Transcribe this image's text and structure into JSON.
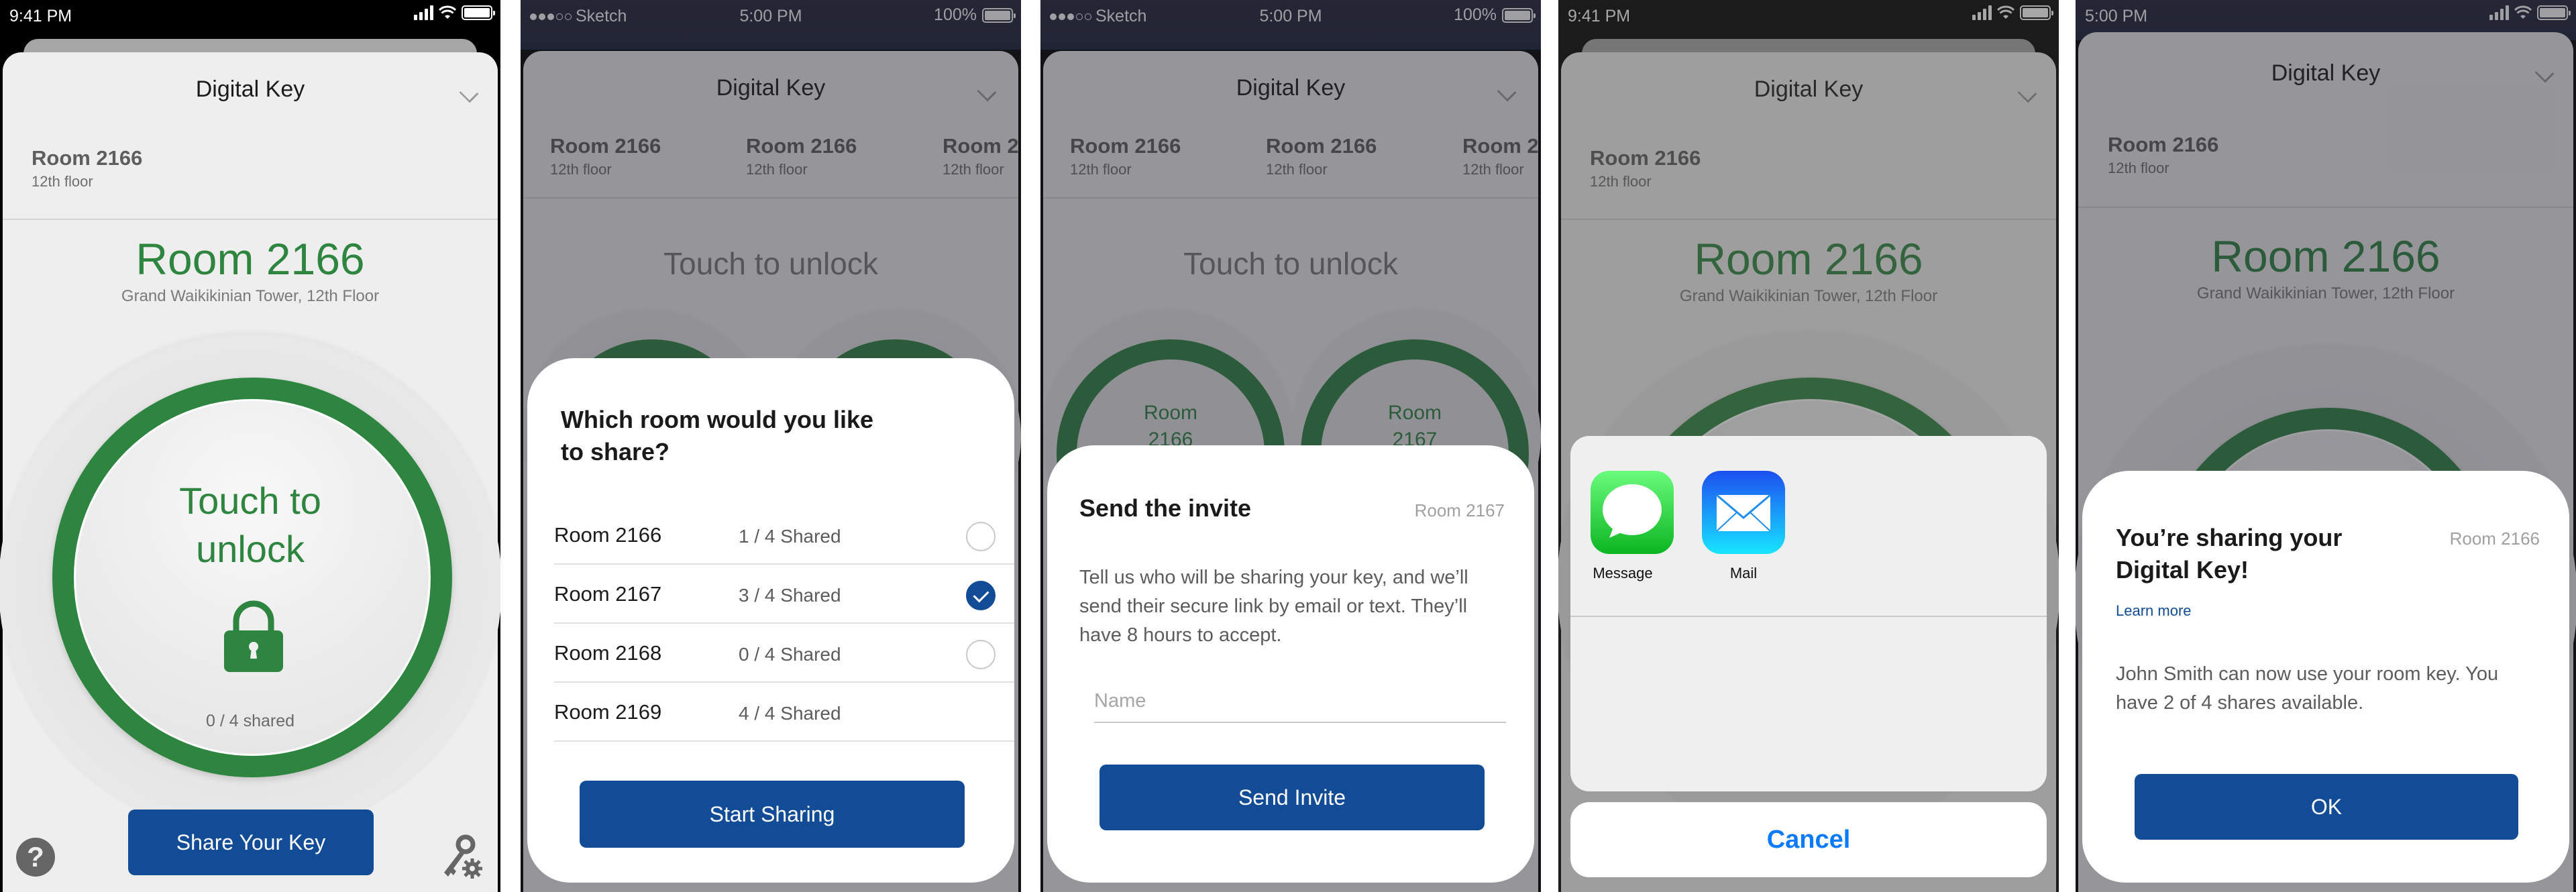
{
  "colors": {
    "brand_green": "#2e8540",
    "brand_blue": "#124b96",
    "ios_blue": "#0a7aff"
  },
  "screens": [
    {
      "status": {
        "time": "9:41 PM"
      },
      "header": {
        "title": "Digital Key"
      },
      "room_tab": {
        "room": "Room 2166",
        "floor": "12th floor"
      },
      "room_title": "Room 2166",
      "room_subtitle": "Grand Waikikinian Tower, 12th Floor",
      "unlock": {
        "line1": "Touch to",
        "line2": "unlock",
        "icon": "lock-icon"
      },
      "shared_count": "0 / 4 shared",
      "share_button": "Share Your Key",
      "help_icon": "?",
      "settings_icon": "key-gear-icon"
    },
    {
      "status": {
        "carrier": "Sketch",
        "time": "5:00 PM",
        "battery": "100%"
      },
      "header": {
        "title": "Digital Key"
      },
      "room_tabs": [
        {
          "room": "Room 2166",
          "floor": "12th floor"
        },
        {
          "room": "Room 2166",
          "floor": "12th floor"
        },
        {
          "room": "Room 2",
          "floor": "12th floor"
        }
      ],
      "touch_text": "Touch to unlock",
      "sheet": {
        "title_line1": "Which room would you like",
        "title_line2": "to share?",
        "rooms": [
          {
            "name": "Room 2166",
            "shared": "1 / 4 Shared",
            "selected": false,
            "selectable": true
          },
          {
            "name": "Room 2167",
            "shared": "3 / 4 Shared",
            "selected": true,
            "selectable": true
          },
          {
            "name": "Room 2168",
            "shared": "0 / 4 Shared",
            "selected": false,
            "selectable": true
          },
          {
            "name": "Room 2169",
            "shared": "4 / 4 Shared",
            "selected": false,
            "selectable": false
          }
        ],
        "button": "Start Sharing"
      }
    },
    {
      "status": {
        "carrier": "Sketch",
        "time": "5:00 PM",
        "battery": "100%"
      },
      "header": {
        "title": "Digital Key"
      },
      "room_tabs": [
        {
          "room": "Room 2166",
          "floor": "12th floor"
        },
        {
          "room": "Room 2166",
          "floor": "12th floor"
        },
        {
          "room": "Room 2",
          "floor": "12th floor"
        }
      ],
      "touch_text": "Touch to unlock",
      "mini_rings": [
        {
          "line1": "Room",
          "line2": "2166"
        },
        {
          "line1": "Room",
          "line2": "2167"
        }
      ],
      "sheet": {
        "title": "Send the invite",
        "room": "Room 2167",
        "body": "Tell us who will be sharing your key, and we’ll send their secure link by email or text. They’ll have 8 hours to accept.",
        "name_placeholder": "Name",
        "name_value": "",
        "button": "Send Invite"
      }
    },
    {
      "status": {
        "time": "9:41 PM"
      },
      "header": {
        "title": "Digital Key"
      },
      "room_tab": {
        "room": "Room 2166",
        "floor": "12th floor"
      },
      "room_title": "Room 2166",
      "room_subtitle": "Grand Waikikinian Tower, 12th Floor",
      "share_sheet": {
        "apps": [
          {
            "label": "Message",
            "icon": "messages-app-icon"
          },
          {
            "label": "Mail",
            "icon": "mail-app-icon"
          }
        ],
        "cancel": "Cancel"
      }
    },
    {
      "status": {
        "time": "5:00 PM"
      },
      "header": {
        "title": "Digital Key"
      },
      "room_tab": {
        "room": "Room 2166",
        "floor": "12th floor"
      },
      "room_title": "Room 2166",
      "room_subtitle": "Grand Waikikinian Tower, 12th Floor",
      "sheet": {
        "title_line1": "You’re sharing your",
        "title_line2": "Digital Key!",
        "room": "Room 2166",
        "learn_more": "Learn more",
        "body": "John Smith can now use your room key. You have 2 of 4 shares available.",
        "button": "OK"
      }
    }
  ]
}
